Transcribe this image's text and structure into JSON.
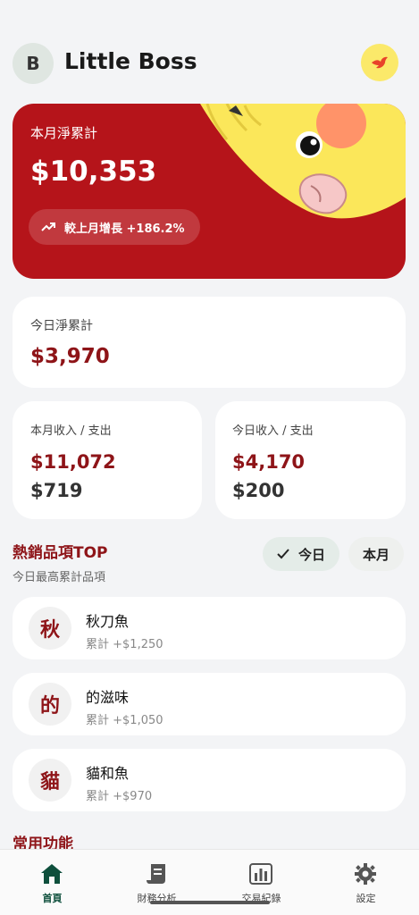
{
  "header": {
    "avatar_initial": "B",
    "title": "Little Boss",
    "bird_icon": "bird-icon"
  },
  "hero": {
    "label": "本月淨累計",
    "value": "$10,353",
    "growth": "較上月增長 +186.2%",
    "growth_icon": "trending-up-icon"
  },
  "today_net": {
    "label": "今日淨累計",
    "value": "$3,970"
  },
  "month_io": {
    "label": "本月收入 / 支出",
    "income": "$11,072",
    "expense": "$719"
  },
  "today_io": {
    "label": "今日收入 / 支出",
    "income": "$4,170",
    "expense": "$200"
  },
  "hot_items": {
    "title": "熱銷品項TOP",
    "subtitle": "今日最高累計品項",
    "chips": [
      {
        "label": "今日",
        "selected": true
      },
      {
        "label": "本月",
        "selected": false
      }
    ],
    "items": [
      {
        "badge": "秋",
        "name": "秋刀魚",
        "sub": "累計 +$1,250"
      },
      {
        "badge": "的",
        "name": "的滋味",
        "sub": "累計 +$1,050"
      },
      {
        "badge": "貓",
        "name": "貓和魚",
        "sub": "累計 +$970"
      }
    ]
  },
  "common": {
    "title": "常用功能"
  },
  "tabbar": {
    "tabs": [
      {
        "label": "首頁",
        "icon": "home-icon",
        "active": true
      },
      {
        "label": "財務分析",
        "icon": "document-icon",
        "active": false
      },
      {
        "label": "交易紀錄",
        "icon": "bar-chart-icon",
        "active": false
      },
      {
        "label": "設定",
        "icon": "gear-icon",
        "active": false
      }
    ]
  },
  "colors": {
    "accent_red": "#b5141a",
    "dark_red_text": "#8e1418",
    "active_green": "#0e4f3c",
    "bird_yellow": "#fbe96a"
  }
}
